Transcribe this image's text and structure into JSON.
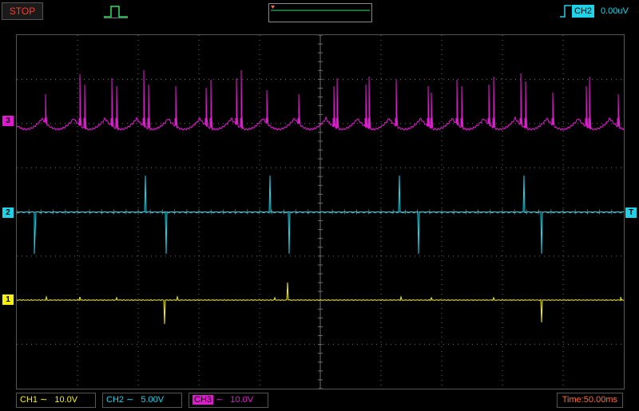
{
  "status": {
    "run_state": "STOP"
  },
  "trigger": {
    "channel": "CH2",
    "level": "0.00uV"
  },
  "markers": {
    "ch1": "1",
    "ch2": "2",
    "ch3": "3",
    "trigger": "T"
  },
  "channels": [
    {
      "label": "CH1",
      "scale": "10.0V",
      "color": "#f5f00e"
    },
    {
      "label": "CH2",
      "scale": "5.00V",
      "color": "#1ed3e8"
    },
    {
      "label": "CH3",
      "scale": "10.0V",
      "color": "#e01ad0"
    }
  ],
  "timebase": {
    "label": "Time:50.00ms"
  },
  "colors": {
    "grid": "#6e6e6e",
    "stop": "#ff3a2a",
    "time": "#ff6a3a"
  }
}
